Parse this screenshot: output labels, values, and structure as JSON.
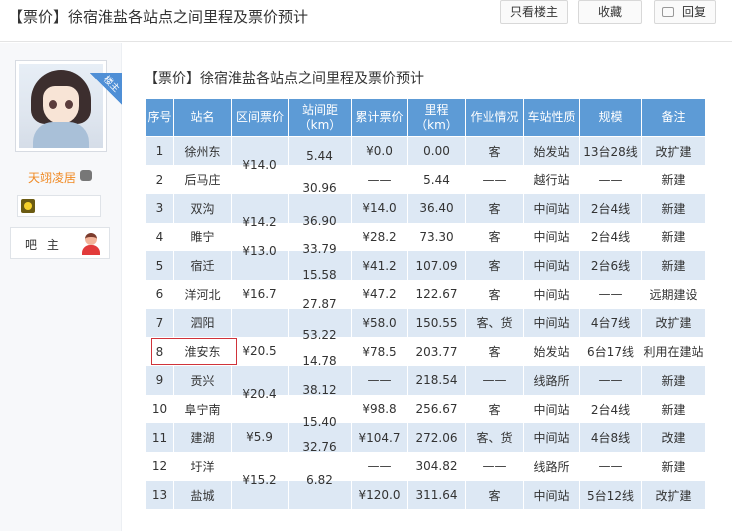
{
  "header": {
    "post_title": "【票价】徐宿淮盐各站点之间里程及票价预计",
    "btn_louzhu": "只看楼主",
    "btn_fav": "收藏",
    "btn_reply": "回复"
  },
  "user": {
    "badge": "楼主",
    "name": "天翊凌居",
    "role": "吧 主"
  },
  "content": {
    "title": "【票价】徐宿淮盐各站点之间里程及票价预计"
  },
  "table": {
    "headers": [
      "序号",
      "站名",
      "区间票价",
      "站间距\n（km）",
      "累计票价",
      "里程\n（km）",
      "作业情况",
      "车站性质",
      "规模",
      "备注"
    ],
    "rows": [
      {
        "no": "1",
        "name": "徐州东",
        "fare_acc": "¥0.0",
        "mileage": "0.00",
        "work": "客",
        "type": "始发站",
        "scale": "13台28线",
        "note": "改扩建"
      },
      {
        "no": "2",
        "name": "后马庄",
        "fare_acc": "——",
        "mileage": "5.44",
        "work": "——",
        "type": "越行站",
        "scale": "——",
        "note": "新建"
      },
      {
        "no": "3",
        "name": "双沟",
        "fare_acc": "¥14.0",
        "mileage": "36.40",
        "work": "客",
        "type": "中间站",
        "scale": "2台4线",
        "note": "新建"
      },
      {
        "no": "4",
        "name": "睢宁",
        "fare_acc": "¥28.2",
        "mileage": "73.30",
        "work": "客",
        "type": "中间站",
        "scale": "2台4线",
        "note": "新建"
      },
      {
        "no": "5",
        "name": "宿迁",
        "fare_acc": "¥41.2",
        "mileage": "107.09",
        "work": "客",
        "type": "中间站",
        "scale": "2台6线",
        "note": "新建"
      },
      {
        "no": "6",
        "name": "洋河北",
        "fare_acc": "¥47.2",
        "mileage": "122.67",
        "work": "客",
        "type": "中间站",
        "scale": "——",
        "note": "远期建设"
      },
      {
        "no": "7",
        "name": "泗阳",
        "fare_acc": "¥58.0",
        "mileage": "150.55",
        "work": "客、货",
        "type": "中间站",
        "scale": "4台7线",
        "note": "改扩建"
      },
      {
        "no": "8",
        "name": "淮安东",
        "fare_acc": "¥78.5",
        "mileage": "203.77",
        "work": "客",
        "type": "始发站",
        "scale": "6台17线",
        "note": "利用在建站"
      },
      {
        "no": "9",
        "name": "贡兴",
        "fare_acc": "——",
        "mileage": "218.54",
        "work": "——",
        "type": "线路所",
        "scale": "——",
        "note": "新建"
      },
      {
        "no": "10",
        "name": "阜宁南",
        "fare_acc": "¥98.8",
        "mileage": "256.67",
        "work": "客",
        "type": "中间站",
        "scale": "2台4线",
        "note": "新建"
      },
      {
        "no": "11",
        "name": "建湖",
        "fare_acc": "¥104.7",
        "mileage": "272.06",
        "work": "客、货",
        "type": "中间站",
        "scale": "4台8线",
        "note": "改建"
      },
      {
        "no": "12",
        "name": "圩洋",
        "fare_acc": "——",
        "mileage": "304.82",
        "work": "——",
        "type": "线路所",
        "scale": "——",
        "note": "新建"
      },
      {
        "no": "13",
        "name": "盐城",
        "fare_acc": "¥120.0",
        "mileage": "311.64",
        "work": "客",
        "type": "中间站",
        "scale": "5台12线",
        "note": "改扩建"
      }
    ],
    "interval_fares": [
      "¥14.0",
      "¥14.2",
      "¥13.0",
      "¥16.7",
      "¥20.5",
      "¥20.4",
      "¥5.9",
      "¥15.2"
    ],
    "distances": [
      "5.44",
      "30.96",
      "36.90",
      "33.79",
      "15.58",
      "27.87",
      "53.22",
      "14.78",
      "38.12",
      "15.40",
      "32.76",
      "6.82"
    ]
  }
}
